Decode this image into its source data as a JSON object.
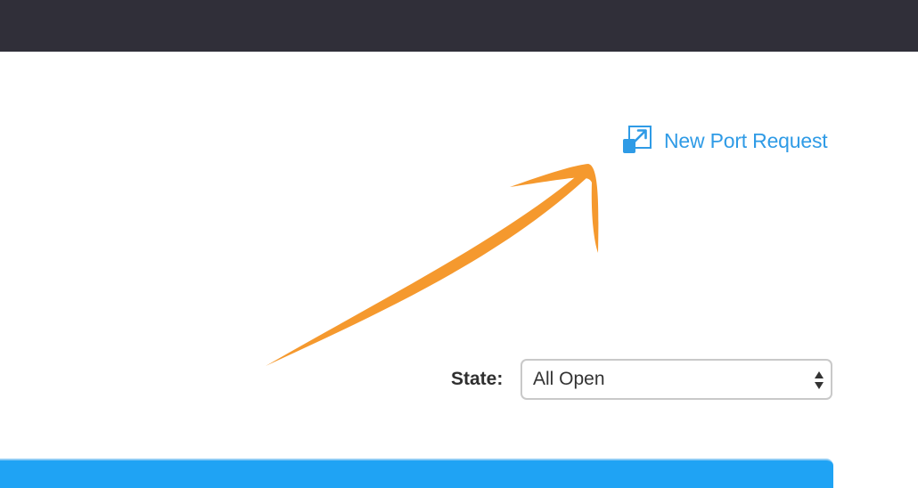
{
  "nav": {},
  "actions": {
    "new_port_request_label": "New Port Request",
    "new_port_request_icon": "external-link-icon"
  },
  "filters": {
    "state_label": "State:",
    "state_value": "All Open"
  },
  "colors": {
    "nav_bg": "#302f39",
    "link": "#2f9be6",
    "annotation_arrow": "#f5992e",
    "table_header": "#1fa3f4"
  }
}
